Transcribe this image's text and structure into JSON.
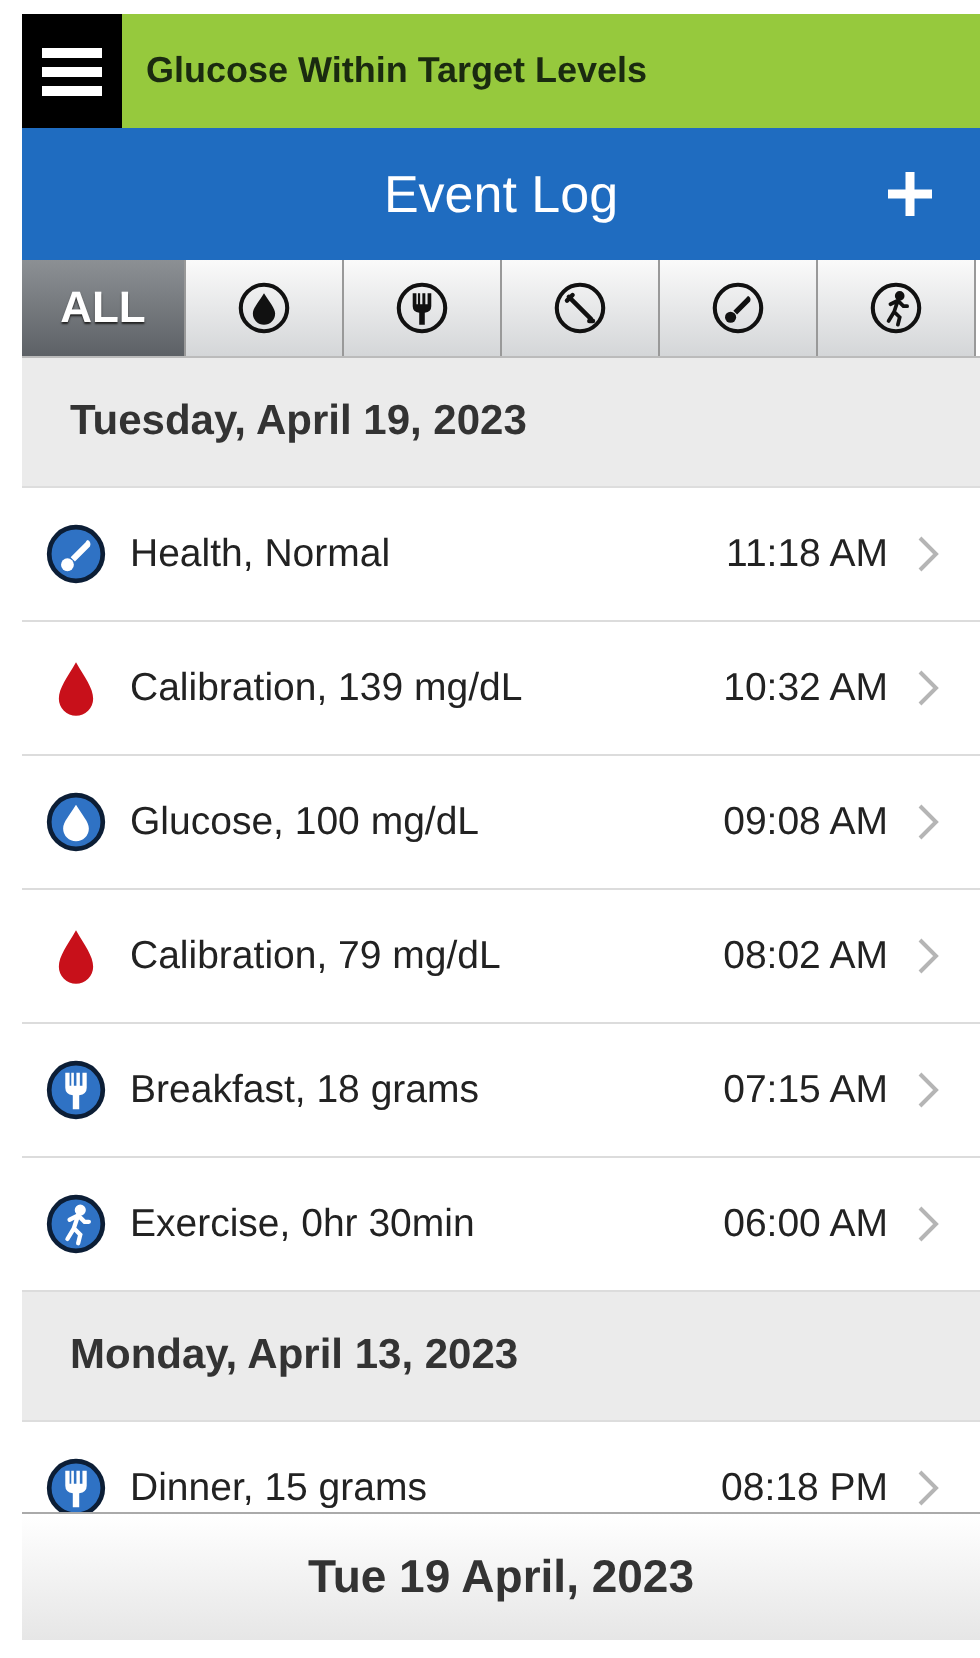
{
  "status_banner": {
    "text": "Glucose Within Target Levels"
  },
  "title_bar": {
    "title": "Event Log"
  },
  "filter_tabs": [
    {
      "kind": "all",
      "label": "ALL",
      "selected": true
    },
    {
      "kind": "glucose",
      "selected": false
    },
    {
      "kind": "meal",
      "selected": false
    },
    {
      "kind": "insulin",
      "selected": false
    },
    {
      "kind": "health",
      "selected": false
    },
    {
      "kind": "exercise",
      "selected": false
    }
  ],
  "sections": [
    {
      "date": "Tuesday, April 19, 2023",
      "events": [
        {
          "kind": "health",
          "text": "Health, Normal",
          "time": "11:18 AM"
        },
        {
          "kind": "calibration",
          "text": "Calibration, 139 mg/dL",
          "time": "10:32 AM"
        },
        {
          "kind": "glucose",
          "text": "Glucose, 100 mg/dL",
          "time": "09:08 AM"
        },
        {
          "kind": "calibration",
          "text": "Calibration, 79 mg/dL",
          "time": "08:02 AM"
        },
        {
          "kind": "meal",
          "text": "Breakfast, 18 grams",
          "time": "07:15 AM"
        },
        {
          "kind": "exercise",
          "text": "Exercise, 0hr 30min",
          "time": "06:00 AM"
        }
      ]
    },
    {
      "date": "Monday, April 13, 2023",
      "events": [
        {
          "kind": "meal",
          "text": "Dinner, 15 grams",
          "time": "08:18 PM"
        }
      ]
    }
  ],
  "date_footer": {
    "text": "Tue 19 April, 2023"
  }
}
